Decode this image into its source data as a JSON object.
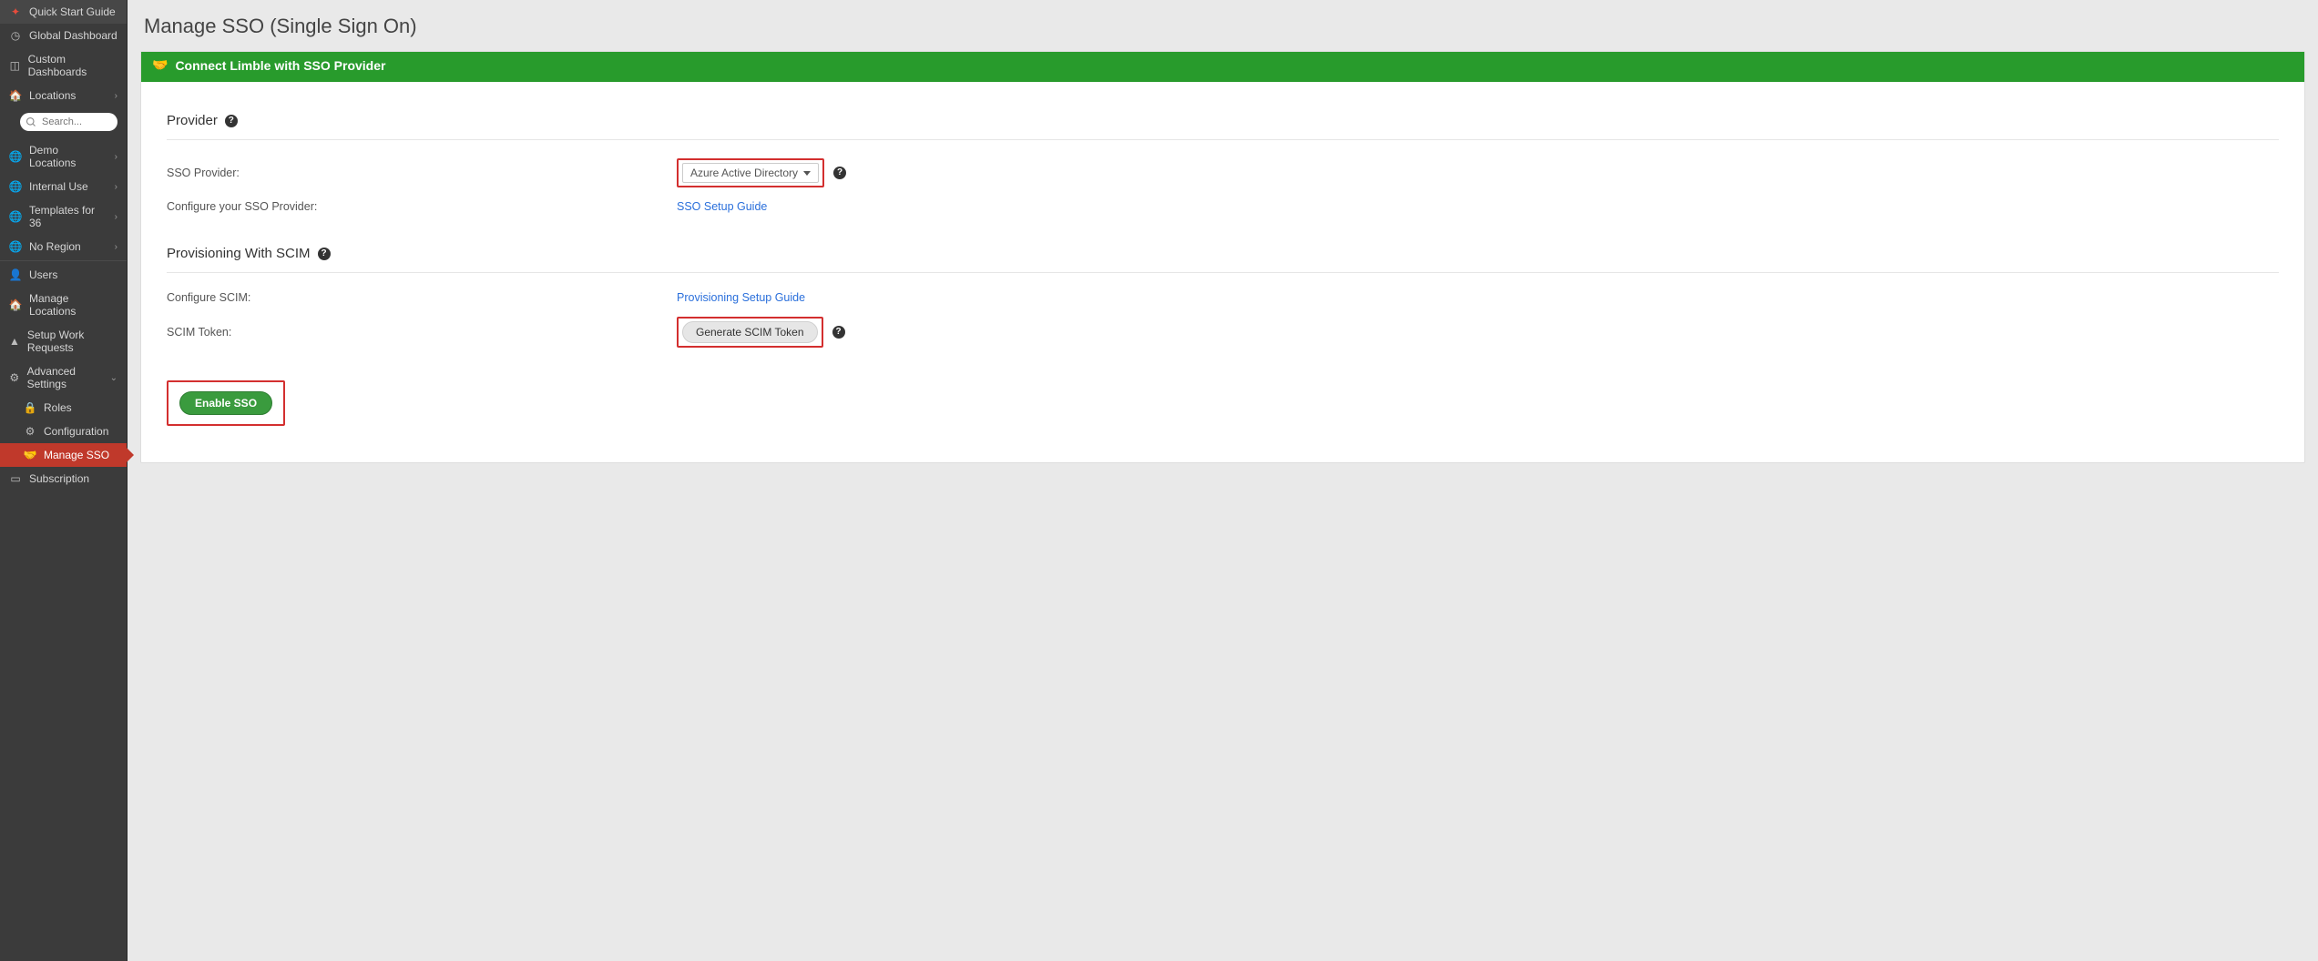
{
  "sidebar": {
    "quick_start": "Quick Start Guide",
    "global_dashboard": "Global Dashboard",
    "custom_dashboards": "Custom Dashboards",
    "locations": "Locations",
    "search_placeholder": "Search...",
    "demo_locations": "Demo Locations",
    "internal_use": "Internal Use",
    "templates_for_36": "Templates for 36",
    "no_region": "No Region",
    "users": "Users",
    "manage_locations": "Manage Locations",
    "setup_work_requests": "Setup Work Requests",
    "advanced_settings": "Advanced Settings",
    "roles": "Roles",
    "configuration": "Configuration",
    "manage_sso": "Manage SSO",
    "subscription": "Subscription"
  },
  "page": {
    "title": "Manage SSO (Single Sign On)",
    "panel_header": "Connect Limble with SSO Provider",
    "section_provider": "Provider",
    "label_sso_provider": "SSO Provider:",
    "dropdown_value": "Azure Active Directory",
    "label_configure_provider": "Configure your SSO Provider:",
    "link_sso_setup_guide": "SSO Setup Guide",
    "section_scim": "Provisioning With SCIM",
    "label_configure_scim": "Configure SCIM:",
    "link_provisioning_guide": "Provisioning Setup Guide",
    "label_scim_token": "SCIM Token:",
    "btn_generate_token": "Generate SCIM Token",
    "btn_enable_sso": "Enable SSO"
  }
}
